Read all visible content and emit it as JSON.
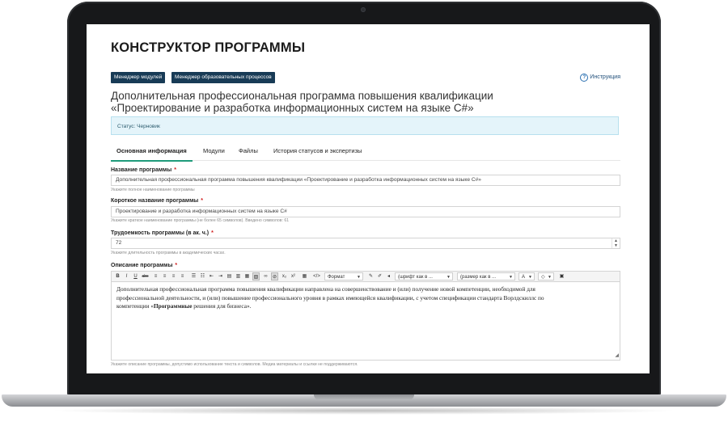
{
  "header": {
    "title": "КОНСТРУКТОР ПРОГРАММЫ",
    "nav": [
      "Менеджер модулей",
      "Менеджер образовательных процессов"
    ],
    "help": {
      "icon": "question-circle-icon",
      "label": "Инструкция"
    }
  },
  "program": {
    "title_line1": "Дополнительная профессиональная программа повышения квалификации",
    "title_line2": "«Проектирование и разработка информационных систем на языке C#»",
    "status": "Статус: Черновик"
  },
  "tabs": [
    "Основная информация",
    "Модули",
    "Файлы",
    "История статусов и экспертизы"
  ],
  "form": {
    "name": {
      "label": "Название программы",
      "value": "Дополнительная профессиональная программа повышения квалификации «Проектирование и разработка информационных систем на языке C#»",
      "hint": "Укажите полное наименование программы"
    },
    "short_name": {
      "label": "Короткое название программы",
      "value": "Проектирование и разработка информационных систем на языке C#",
      "hint": "Укажите краткое наименование программы (не более 65 символов). Введено символов: 61"
    },
    "hours": {
      "label": "Трудоемкость программы (в ак. ч.)",
      "value": "72",
      "hint": "Укажите длительность программы в академических часах."
    },
    "description": {
      "label": "Описание программы",
      "text_line1": "Дополнительная профессиональная программа повышения квалификации направлена на совершенствование и (или) получение новой компетенции, необходимой для",
      "text_line2": "профессиональной деятельности, и (или) повышение профессионального уровня в рамках имеющейся квалификации, с учетом спецификации стандарта Ворлдскиллс по",
      "text_line3_a": "компетенции «",
      "text_line3_bold": "Программные",
      "text_line3_b": " решения для бизнеса».",
      "hint": "Укажите описание программы, допустимо использование текста и символов. Медиа материалы и ссылки не поддерживаются."
    },
    "required_mark": "*"
  },
  "toolbar": {
    "bold": "B",
    "italic": "I",
    "underline": "U",
    "strike": "abc",
    "format": "Формат",
    "font": "(шрифт как в ...",
    "size": "(размер как в ...",
    "font_color": "A",
    "source": "</>",
    "sub": "x₂",
    "sup": "x²",
    "clear": "✕"
  },
  "colors": {
    "nav_bg": "#183b56",
    "tab_active": "#1f9b7a",
    "status_bg": "#e4f4fa",
    "required": "#d01a1a"
  }
}
